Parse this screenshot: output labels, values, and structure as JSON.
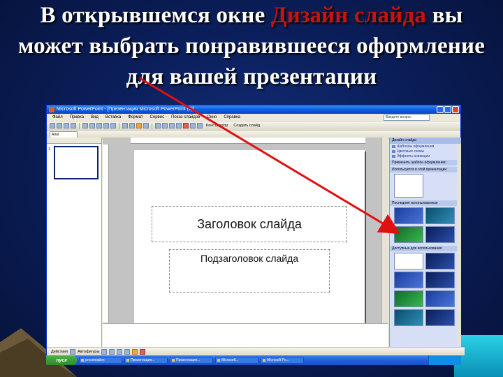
{
  "slide": {
    "title_part1": "В открывшемся окне ",
    "title_highlight": "Дизайн слайда",
    "title_part2": " вы может выбрать понравившееся оформление для вашей презентации"
  },
  "app": {
    "window_title": "Microsoft PowerPoint - [Презентация Microsoft PowerPoint (2)]",
    "menu": [
      "Файл",
      "Правка",
      "Вид",
      "Вставка",
      "Формат",
      "Сервис",
      "Показ слайдов",
      "Окно",
      "Справка"
    ],
    "help_box_placeholder": "Введите вопрос",
    "font_name": "Arial",
    "toolbar_design_label": "Конструктор",
    "toolbar_create_slide_label": "Создать слайд",
    "slide_number": "1",
    "placeholder_title": "Заголовок слайда",
    "placeholder_subtitle": "Подзаголовок слайда",
    "taskpane": {
      "header": "Дизайн слайда",
      "links": [
        "Шаблоны оформления",
        "Цветовые схемы",
        "Эффекты анимации"
      ],
      "section_applied": "Применить шаблон оформления:",
      "section_current": "Используется в этой презентации",
      "section_recent": "Последние использованные",
      "section_available": "Доступные для использования"
    },
    "drawbar_label": "Действия",
    "drawbar_autoshapes": "Автофигуры",
    "taskbar": {
      "start": "пуск",
      "items": [
        "presentation",
        "Презентация...",
        "Презентация...",
        "Microsoft...",
        "Microsoft Po..."
      ]
    }
  },
  "colors": {
    "highlight": "#cc1111",
    "background": "#0b1f5c",
    "arrow": "#e01010"
  }
}
